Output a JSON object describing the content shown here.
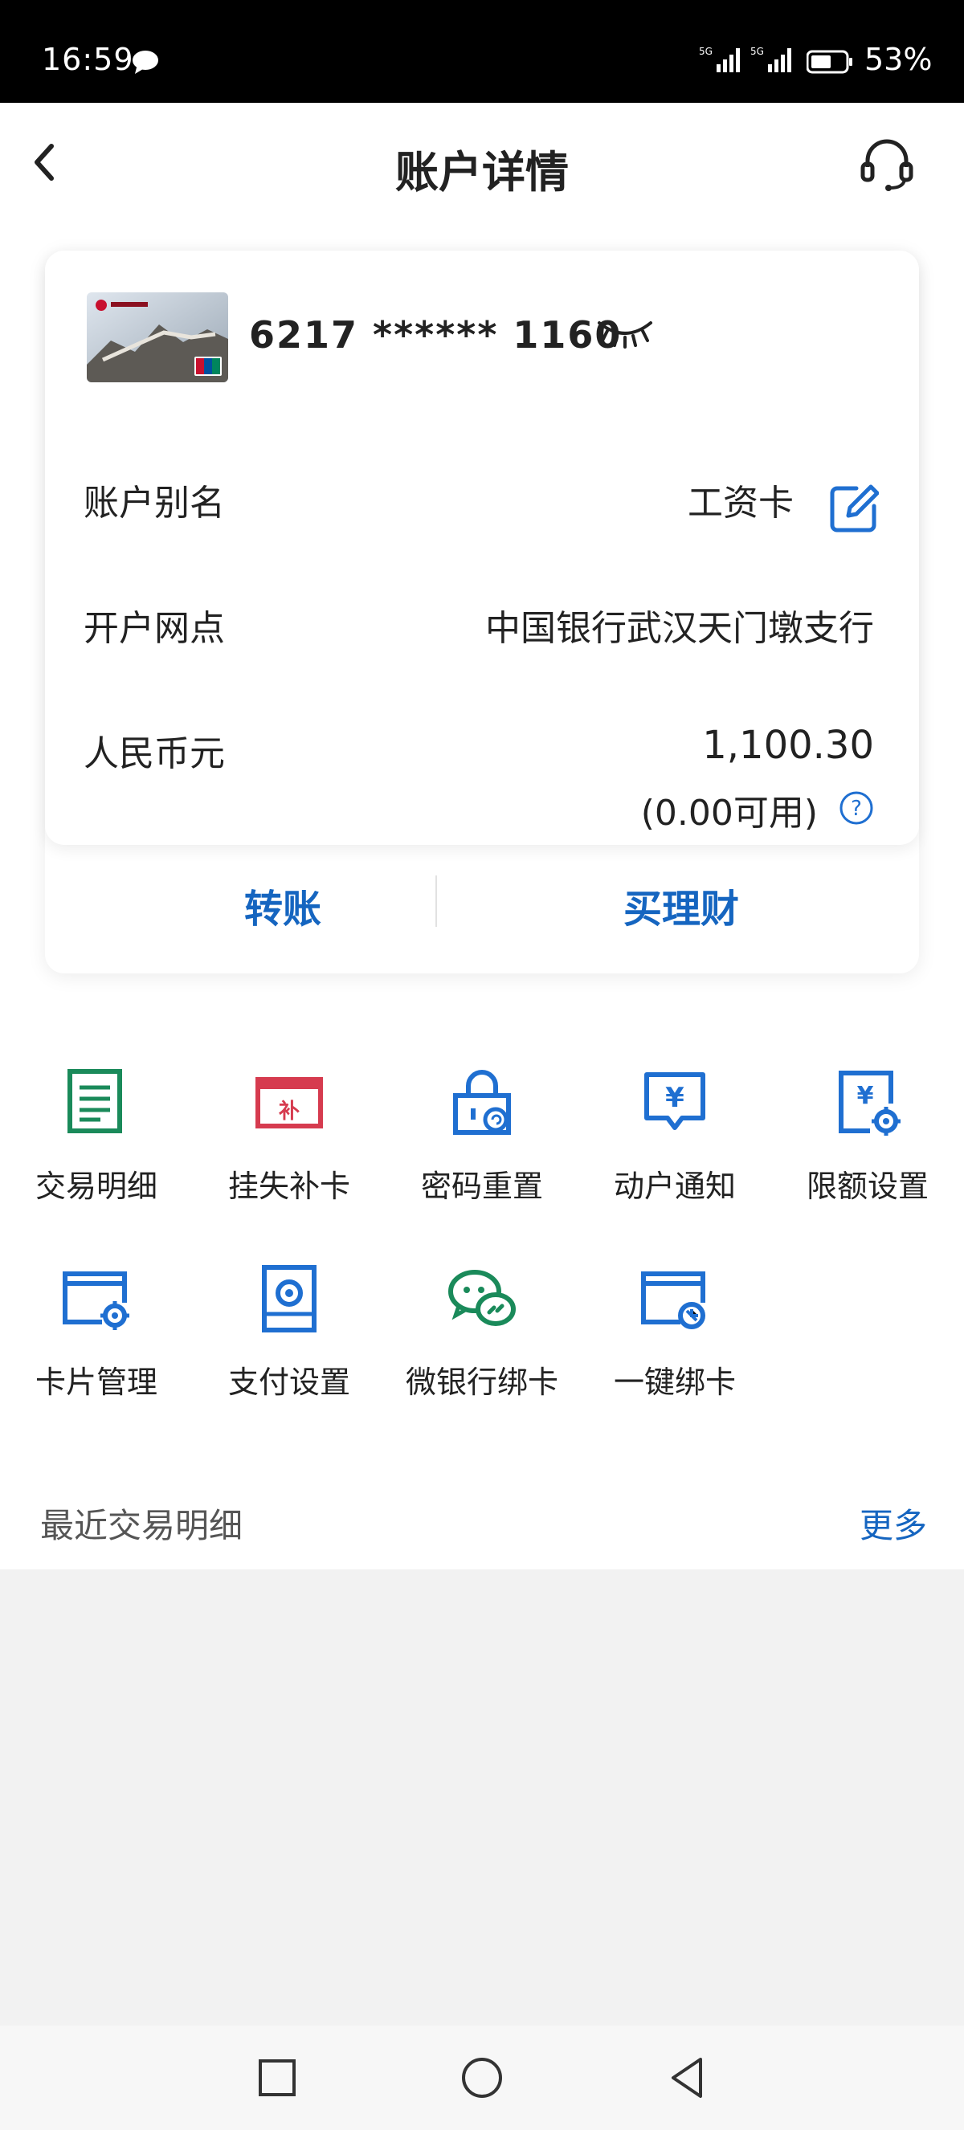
{
  "status_bar": {
    "time": "16:59",
    "network1": "5G",
    "network2": "5G",
    "battery": "53%"
  },
  "header": {
    "title": "账户详情"
  },
  "card": {
    "number": "6217 ****** 1160",
    "rows": [
      {
        "label": "账户别名",
        "value": "工资卡"
      },
      {
        "label": "开户网点",
        "value": "中国银行武汉天门墩支行"
      },
      {
        "label": "人民币元",
        "value": "1,100.30",
        "sub": "(0.00可用)"
      }
    ],
    "actions": [
      "转账",
      "买理财"
    ]
  },
  "functions": [
    {
      "label": "交易明细",
      "icon": "document-list-icon",
      "color": "#1a8a5a"
    },
    {
      "label": "挂失补卡",
      "icon": "card-report-icon",
      "color": "#d63b4f"
    },
    {
      "label": "密码重置",
      "icon": "lock-reset-icon",
      "color": "#1f6fd1"
    },
    {
      "label": "动户通知",
      "icon": "yuan-message-icon",
      "color": "#1f6fd1"
    },
    {
      "label": "限额设置",
      "icon": "yuan-gear-icon",
      "color": "#1f6fd1"
    },
    {
      "label": "卡片管理",
      "icon": "card-gear-icon",
      "color": "#1f6fd1"
    },
    {
      "label": "支付设置",
      "icon": "payment-settings-icon",
      "color": "#1f6fd1"
    },
    {
      "label": "微银行绑卡",
      "icon": "wechat-bind-icon",
      "color": "#1a8a5a"
    },
    {
      "label": "一键绑卡",
      "icon": "card-link-icon",
      "color": "#1f6fd1"
    }
  ],
  "recent": {
    "title": "最近交易明细",
    "more": "更多"
  },
  "colors": {
    "accent": "#1565c0",
    "green": "#1a8a5a",
    "red": "#d63b4f",
    "blue": "#1f6fd1"
  }
}
